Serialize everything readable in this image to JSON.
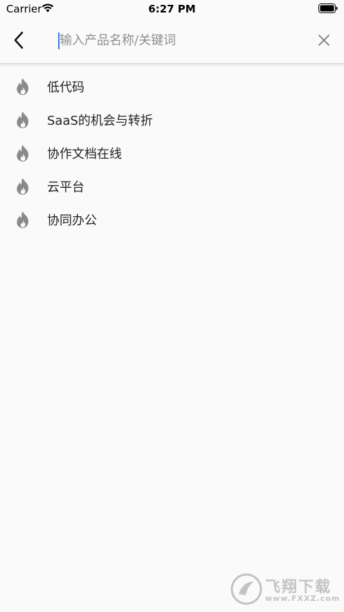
{
  "status_bar": {
    "carrier": "Carrier",
    "time": "6:27 PM"
  },
  "search": {
    "placeholder": "输入产品名称/关键词",
    "value": ""
  },
  "hot_searches": [
    {
      "label": "低代码",
      "icon": "flame-icon"
    },
    {
      "label": "SaaS的机会与转折",
      "icon": "flame-icon"
    },
    {
      "label": "协作文档在线",
      "icon": "flame-icon"
    },
    {
      "label": "云平台",
      "icon": "flame-icon"
    },
    {
      "label": "协同办公",
      "icon": "flame-icon"
    }
  ],
  "colors": {
    "background": "#fafafa",
    "icon_gray": "#8a8a8a",
    "caret_blue": "#2f7cf6",
    "text": "#222222"
  },
  "watermark": {
    "text": "飞翔下载",
    "url": "www.FXXZ.com"
  }
}
